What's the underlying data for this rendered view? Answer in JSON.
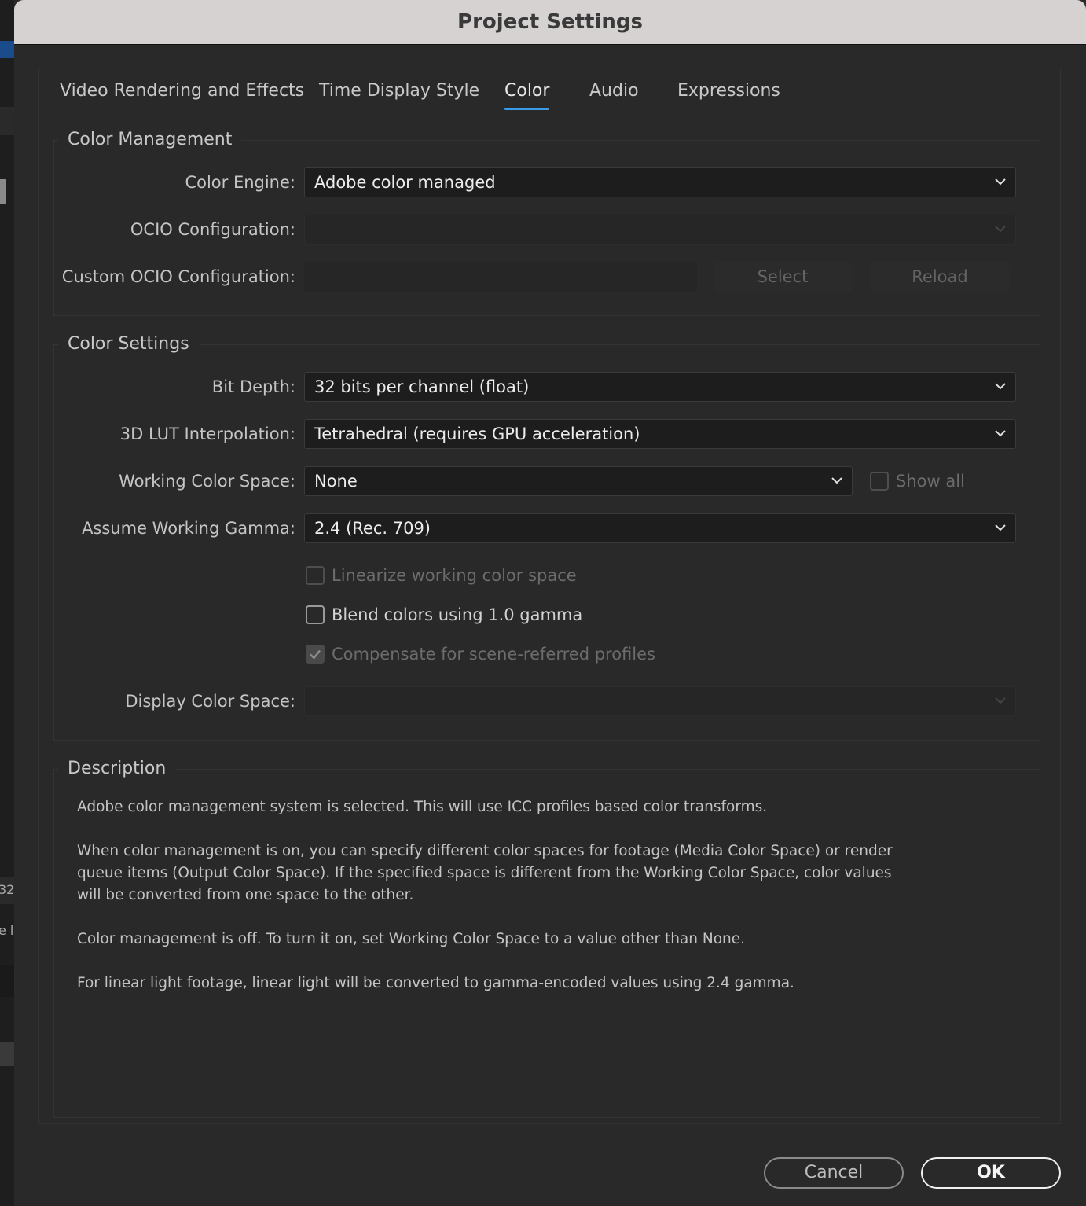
{
  "window": {
    "title": "Project Settings"
  },
  "background_app": {
    "text_a": "32",
    "text_b": "e l"
  },
  "tabs": [
    {
      "label": "Video Rendering and Effects",
      "active": false
    },
    {
      "label": "Time Display Style",
      "active": false
    },
    {
      "label": "Color",
      "active": true
    },
    {
      "label": "Audio",
      "active": false
    },
    {
      "label": "Expressions",
      "active": false
    }
  ],
  "color_management": {
    "title": "Color Management",
    "engine_label": "Color Engine:",
    "engine_value": "Adobe color managed",
    "ocio_label": "OCIO Configuration:",
    "ocio_value": "",
    "custom_ocio_label": "Custom OCIO Configuration:",
    "custom_ocio_value": "",
    "select_button": "Select",
    "reload_button": "Reload"
  },
  "color_settings": {
    "title": "Color Settings",
    "bit_depth_label": "Bit Depth:",
    "bit_depth_value": "32 bits per channel (float)",
    "lut_label": "3D LUT Interpolation:",
    "lut_value": "Tetrahedral (requires GPU acceleration)",
    "working_space_label": "Working Color Space:",
    "working_space_value": "None",
    "show_all_label": "Show all",
    "show_all_checked": false,
    "gamma_label": "Assume Working Gamma:",
    "gamma_value": "2.4 (Rec. 709)",
    "linearize_label": "Linearize working color space",
    "linearize_checked": false,
    "blend_label": "Blend colors using 1.0 gamma",
    "blend_checked": false,
    "compensate_label": "Compensate for scene-referred profiles",
    "compensate_checked": true,
    "display_space_label": "Display Color Space:",
    "display_space_value": ""
  },
  "description": {
    "title": "Description",
    "lines": [
      "Adobe color management system is selected. This will use ICC profiles based color transforms.",
      "When color management is on, you can specify different color spaces for footage (Media Color Space) or render",
      "queue items (Output Color Space). If the specified space is different from the Working Color Space, color values",
      "will be converted from one space to the other.",
      "Color management is off. To turn it on, set Working Color Space to a value other than None.",
      "For linear light footage, linear light will be converted to gamma-encoded values using 2.4 gamma."
    ]
  },
  "footer": {
    "cancel_label": "Cancel",
    "ok_label": "OK"
  },
  "colors": {
    "accent": "#3a9be8",
    "dialog_bg": "#292929",
    "titlebar_bg": "#d6d2d2"
  },
  "icons": {
    "dropdown": "chevron-down-icon",
    "check": "checkmark-icon"
  }
}
